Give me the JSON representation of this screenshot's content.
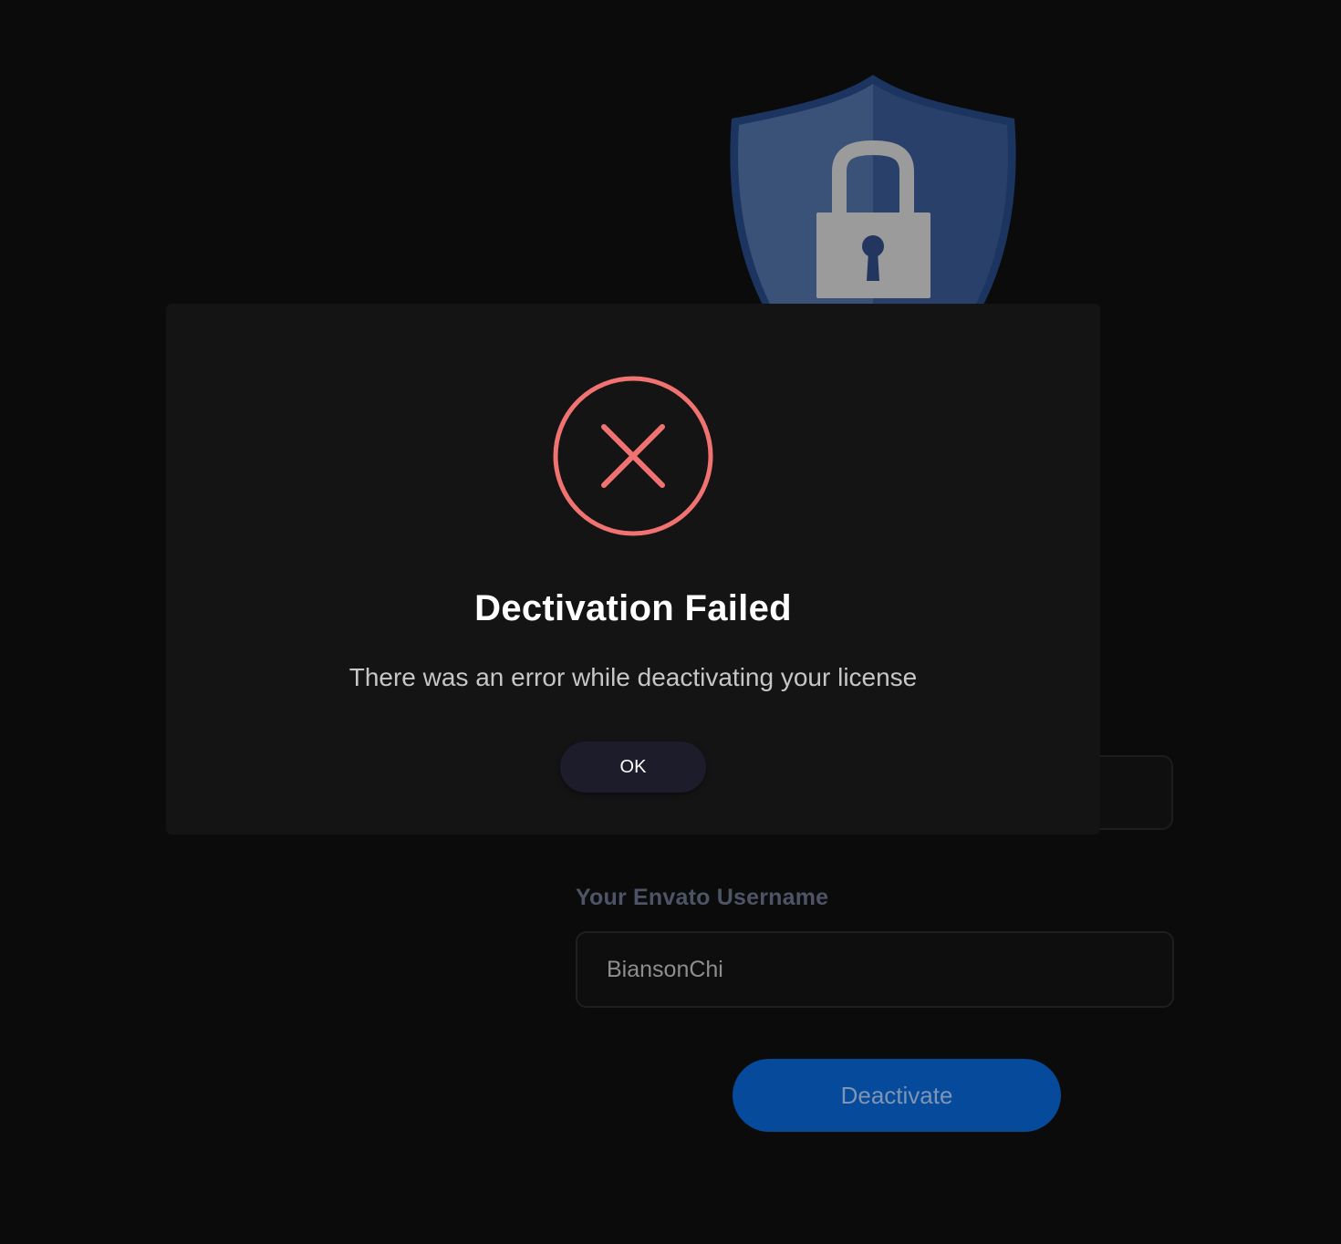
{
  "background": {
    "shield_icon": "shield-lock-icon",
    "username": {
      "label": "Your Envato Username",
      "value": "BiansonChi"
    },
    "deactivate_label": "Deactivate",
    "colors": {
      "page_bg": "#0b0b0b",
      "shield": "#233e6e",
      "button": "#064a9c"
    }
  },
  "modal": {
    "icon": "error-x-icon",
    "title": "Dectivation Failed",
    "message": "There was an error while deactivating your license",
    "ok_label": "OK",
    "colors": {
      "error": "#f07372",
      "bg": "#141414"
    }
  }
}
